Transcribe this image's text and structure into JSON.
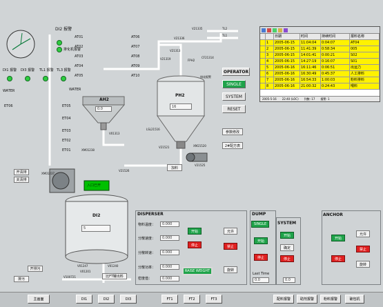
{
  "top": {
    "alarm_label": "DI2 报警",
    "sample_label": "排化机报警"
  },
  "left_alarms": {
    "di1": "DI1 报警",
    "di3": "DI3 报警",
    "tl1": "TL1 报警",
    "tl3": "TL3 报警"
  },
  "water_labels": [
    "WATER",
    "WATER"
  ],
  "et_labels": [
    "ET06",
    "ET05",
    "ET04",
    "ET03",
    "ET02",
    "ET01"
  ],
  "at_labels": [
    "AT01",
    "AT02",
    "AT03",
    "AT04",
    "AT05",
    "AT06",
    "AT07",
    "AT08",
    "AT09",
    "AT10"
  ],
  "tanks": {
    "ah2": {
      "name": "AH2",
      "value": "0.0"
    },
    "ph2": {
      "name": "PH2",
      "value": "16"
    },
    "di2": {
      "name": "DI2",
      "value": "5"
    }
  },
  "valves": {
    "v21313": "V21313",
    "v21336": "V21336",
    "v21335": "V21335",
    "cf21314": "CF21314",
    "v21319": "V21319",
    "fph2": "FPH2",
    "ph_alarm": "排化报警",
    "v01313": "V01313",
    "xm01238": "XM01238",
    "xm01237": "XM01237",
    "v21526": "V21526",
    "v21521": "V21521",
    "xm21520": "XM21520",
    "v21525": "V21525",
    "lsl": "LSL21516",
    "v01247": "V01247",
    "v01240": "V01240",
    "v01201": "V01201",
    "v100721": "V100721",
    "tl2": "TL2",
    "tl1": "TL1"
  },
  "side_buttons": {
    "pump": "开清排",
    "close": "关清排"
  },
  "left_buttons": {
    "open": "开排污",
    "drain": "排污"
  },
  "ph_buttons": {
    "operator": "OPERATOR",
    "single": "SINGLE",
    "system": "SYSTEM",
    "reset": "RESET",
    "param": "参数修改",
    "prog": "2#配方表",
    "feed": "加料"
  },
  "green_label": "入口已开",
  "cross_label": "比FT罐出料",
  "table": {
    "headers": [
      "",
      "日期",
      "时间",
      "持续时间",
      "报料名称"
    ],
    "rows": [
      [
        "1",
        "2005-06-15",
        "11:04:04",
        "0:04:07",
        "AT04"
      ],
      [
        "2",
        "2005-06-15",
        "11:41:39",
        "0:58:34",
        "005"
      ],
      [
        "3",
        "2005-06-15",
        "14:01:41",
        "0:00:21",
        "S02"
      ],
      [
        "4",
        "2005-06-15",
        "14:27:19",
        "0:16:07",
        "S01"
      ],
      [
        "5",
        "2005-06-16",
        "16:11:46",
        "0:06:51",
        "出运力"
      ],
      [
        "6",
        "2005-06-16",
        "16:30:49",
        "0:45:37",
        "人工排料"
      ],
      [
        "7",
        "2005-06-16",
        "16:54:33",
        "1:00:03",
        "粉料排料"
      ],
      [
        "8",
        "2005-06-16",
        "21:00:32",
        "0:24:43",
        "喂料"
      ]
    ],
    "status": [
      "2005-5-16",
      "22:40 (LOC)",
      "列数: 17",
      "报警: 1"
    ]
  },
  "disperser": {
    "title": "DISPERSER",
    "rows": [
      {
        "label": "物料温度：",
        "value": "0.000"
      },
      {
        "label": "分散速度：",
        "value": "0.000"
      },
      {
        "label": "分散转速：",
        "value": "0.000"
      },
      {
        "label": "分散功率：",
        "value": "0.000"
      },
      {
        "label": "密度值：",
        "value": "0.000"
      }
    ],
    "start": "开始",
    "stop": "停止",
    "allow": "允许",
    "prohibit": "禁止",
    "rotate": "旋转",
    "raise": "RAISE WEIGHT"
  },
  "dump": {
    "title": "DUMP",
    "single": "SINGLE",
    "system": "SYSTEM",
    "start": "开始",
    "stop": "停止",
    "confirm": "确定",
    "open": "开始",
    "close": "停止",
    "last_time_label": "Last Time",
    "last_time": "0.0",
    "value2": "0.0"
  },
  "anchor": {
    "title": "ANCHOR",
    "start": "开始",
    "stop": "停止",
    "allow": "允许",
    "prohibit": "禁止",
    "rotate": "旋转"
  },
  "nav": [
    "主画面",
    "DI1",
    "DI2",
    "DI3",
    "FT1",
    "FT2",
    "FT3",
    "配料报警",
    "助剂报警",
    "粉料报警",
    "破包机"
  ],
  "colors": {
    "green": "#1fa34a",
    "red": "#e02020",
    "yellow": "#fff200",
    "pipe": "#ffffff"
  }
}
